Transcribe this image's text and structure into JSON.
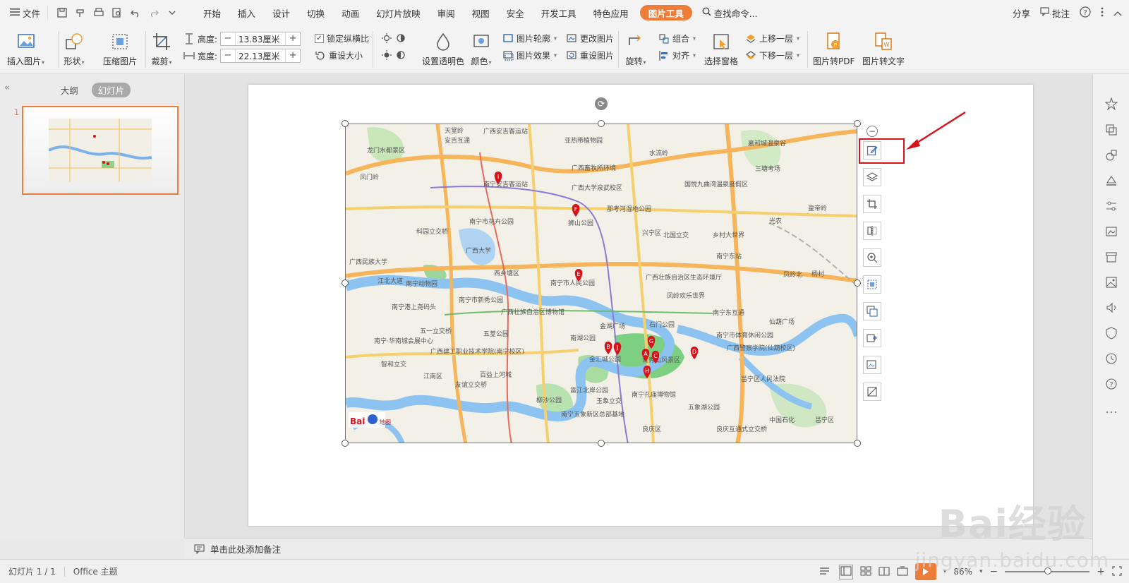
{
  "menubar": {
    "file_label": "文件",
    "tabs": [
      "开始",
      "插入",
      "设计",
      "切换",
      "动画",
      "幻灯片放映",
      "审阅",
      "视图",
      "安全",
      "开发工具",
      "特色应用",
      "图片工具"
    ],
    "active_tab": "图片工具",
    "search_label": "查找命令...",
    "share_label": "分享",
    "comment_label": "批注"
  },
  "ribbon": {
    "insert_picture": "插入图片",
    "shape": "形状",
    "compress": "压缩图片",
    "crop": "裁剪",
    "height_label": "高度:",
    "height_value": "13.83厘米",
    "width_label": "宽度:",
    "width_value": "22.13厘米",
    "lock_ratio": "锁定纵横比",
    "reset_size": "重设大小",
    "set_transparent": "设置透明色",
    "color": "颜色",
    "picture_outline": "图片轮廓",
    "picture_effect": "图片效果",
    "change_picture": "更改图片",
    "reset_picture": "重设图片",
    "rotate": "旋转",
    "group": "组合",
    "align": "对齐",
    "selection_pane": "选择窗格",
    "bring_forward": "上移一层",
    "send_backward": "下移一层",
    "to_pdf": "图片转PDF",
    "to_text": "图片转文字"
  },
  "left_panel": {
    "outline_tab": "大纲",
    "slides_tab": "幻灯片",
    "slide_number": "1"
  },
  "notes": {
    "placeholder": "单击此处添加备注"
  },
  "status": {
    "slide_info": "幻灯片 1 / 1",
    "theme": "Office 主题",
    "zoom": "86%"
  },
  "watermark": {
    "main": "Bai经验",
    "sub": "jingyan.baidu.com"
  },
  "colors": {
    "accent": "#ee7d3a",
    "highlight": "#d6131b"
  },
  "icons": [
    "menu-icon",
    "save-icon",
    "print-icon",
    "undo-icon",
    "redo-icon",
    "search-icon",
    "help-icon",
    "more-icon",
    "edit-icon",
    "layers-icon",
    "crop-icon",
    "flip-icon",
    "zoom-in-icon",
    "frame-icon",
    "copy-icon",
    "cut-icon",
    "replace-icon",
    "image-icon"
  ],
  "map": {
    "labels": [
      "天堂岭",
      "安吉互通",
      "广西安吉客运站",
      "龙门水都景区",
      "风门岭",
      "亚热带植物园",
      "广西畜牧所环境",
      "水流岭",
      "嘉和城温泉谷",
      "三塘考场",
      "南宁安吉客运站",
      "广西大学泉武校区",
      "国悦九曲湾温泉度假区",
      "南宁市花卉公园",
      "那考河湿地公园",
      "皇帝岭",
      "科园立交桥",
      "狮山公园",
      "兴宁区",
      "北国立交",
      "乡村大世界",
      "光农",
      "广西大学",
      "南宁东站",
      "广西民族大学",
      "江北大道",
      "西乡塘区",
      "广西壮族自治区生态环境厅",
      "南宁动物园",
      "南宁市人民公园",
      "凤岭北",
      "杨村",
      "南宁市新秀公园",
      "凤岭欢乐世界",
      "南宁港上尧码头",
      "广西壮族自治区博物馆",
      "金湖广场",
      "石门公园",
      "南宁东互通",
      "仙葫广场",
      "五一立交桥",
      "五菱公园",
      "南湖公园",
      "南宁市体育休闲公园",
      "南宁·华南城会展中心",
      "广西建工职业技术学院(南宁校区)",
      "金汇城公园",
      "青秀山风景区",
      "广西警察学院(仙葫校区)",
      "智和立交",
      "江南区",
      "百益上河城",
      "邕江北岸公园",
      "邕宁区人民法院",
      "友谊立交桥",
      "南宁孔庙博物馆",
      "柳沙公园",
      "玉象立交",
      "南宁五象新区总部基地",
      "五象湖公园",
      "良庆区",
      "良庆互通式立交桥",
      "中国石化",
      "邕宁区"
    ],
    "markers": [
      "A",
      "B",
      "C",
      "D",
      "E",
      "F",
      "G",
      "H",
      "I",
      "J"
    ],
    "logo": "Bai地图"
  }
}
